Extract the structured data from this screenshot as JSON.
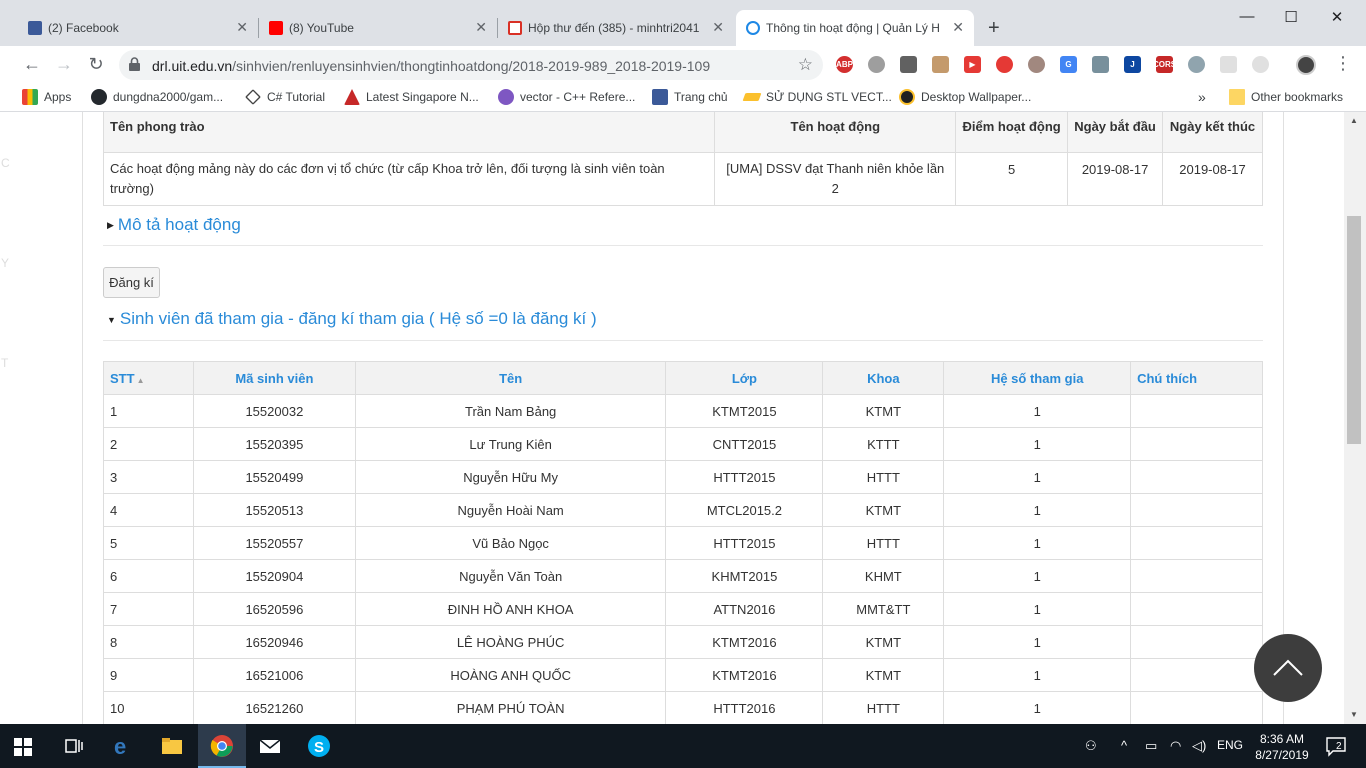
{
  "tabs": [
    {
      "title": "(2) Facebook",
      "icon": "facebook-icon",
      "color": "#3b5998"
    },
    {
      "title": "(8) YouTube",
      "icon": "youtube-icon",
      "color": "#ff0000"
    },
    {
      "title": "Hộp thư đến (385) - minhtri2041",
      "icon": "gmail-icon",
      "color": "#d93025"
    },
    {
      "title": "Thông tin hoạt động | Quản Lý H",
      "icon": "ie-icon",
      "color": "#1e88e5"
    }
  ],
  "omnibox": {
    "host": "drl.uit.edu.vn",
    "path": "/sinhvien/renluyensinhvien/thongtinhoatdong/2018-2019-989_2018-2019-109"
  },
  "bookmarks": [
    {
      "label": "Apps",
      "icon": "apps-icon"
    },
    {
      "label": "dungdna2000/gam...",
      "icon": "github-icon"
    },
    {
      "label": "C# Tutorial",
      "icon": "csharp-icon"
    },
    {
      "label": "Latest Singapore N...",
      "icon": "news-icon"
    },
    {
      "label": "vector - C++ Refere...",
      "icon": "cpp-icon"
    },
    {
      "label": "Trang chủ",
      "icon": "facebook-icon"
    },
    {
      "label": "SỬ DỤNG STL VECT...",
      "icon": "pencil-icon"
    },
    {
      "label": "Desktop Wallpaper...",
      "icon": "wallpaper-icon"
    },
    {
      "label": "Other bookmarks",
      "icon": "folder-icon"
    }
  ],
  "info_table": {
    "headers": [
      "Tên phong trào",
      "Tên hoạt động",
      "Điểm hoạt động",
      "Ngày bắt đầu",
      "Ngày kết thúc"
    ],
    "row": [
      "Các hoạt động mảng này do các đơn vị tổ chức (từ cấp Khoa trở lên, đối tượng là sinh viên toàn trường)",
      "[UMA] DSSV đạt Thanh niên khỏe lần 2",
      "5",
      "2019-08-17",
      "2019-08-17"
    ]
  },
  "description_toggle": "Mô tả hoạt động",
  "register_button": "Đăng kí",
  "participants_toggle": "Sinh viên đã tham gia - đăng kí tham gia ( Hệ số =0 là đăng kí )",
  "students_table": {
    "headers": [
      "STT",
      "Mã sinh viên",
      "Tên",
      "Lớp",
      "Khoa",
      "Hệ số tham gia",
      "Chú thích"
    ],
    "rows": [
      [
        "1",
        "15520032",
        "Trần Nam Bảng",
        "KTMT2015",
        "KTMT",
        "1",
        ""
      ],
      [
        "2",
        "15520395",
        "Lư Trung Kiên",
        "CNTT2015",
        "KTTT",
        "1",
        ""
      ],
      [
        "3",
        "15520499",
        "Nguyễn Hữu My",
        "HTTT2015",
        "HTTT",
        "1",
        ""
      ],
      [
        "4",
        "15520513",
        "Nguyễn Hoài Nam",
        "MTCL2015.2",
        "KTMT",
        "1",
        ""
      ],
      [
        "5",
        "15520557",
        "Vũ Bảo Ngọc",
        "HTTT2015",
        "HTTT",
        "1",
        ""
      ],
      [
        "6",
        "15520904",
        "Nguyễn Văn Toàn",
        "KHMT2015",
        "KHMT",
        "1",
        ""
      ],
      [
        "7",
        "16520596",
        "ĐINH HỒ ANH KHOA",
        "ATTN2016",
        "MMT&TT",
        "1",
        ""
      ],
      [
        "8",
        "16520946",
        "LÊ HOÀNG PHÚC",
        "KTMT2016",
        "KTMT",
        "1",
        ""
      ],
      [
        "9",
        "16521006",
        "HOÀNG ANH QUỐC",
        "KTMT2016",
        "KTMT",
        "1",
        ""
      ],
      [
        "10",
        "16521260",
        "PHẠM PHÚ TOÀN",
        "HTTT2016",
        "HTTT",
        "1",
        ""
      ]
    ]
  },
  "taskbar": {
    "language": "ENG",
    "time": "8:36 AM",
    "date": "8/27/2019",
    "notifications": "2"
  }
}
